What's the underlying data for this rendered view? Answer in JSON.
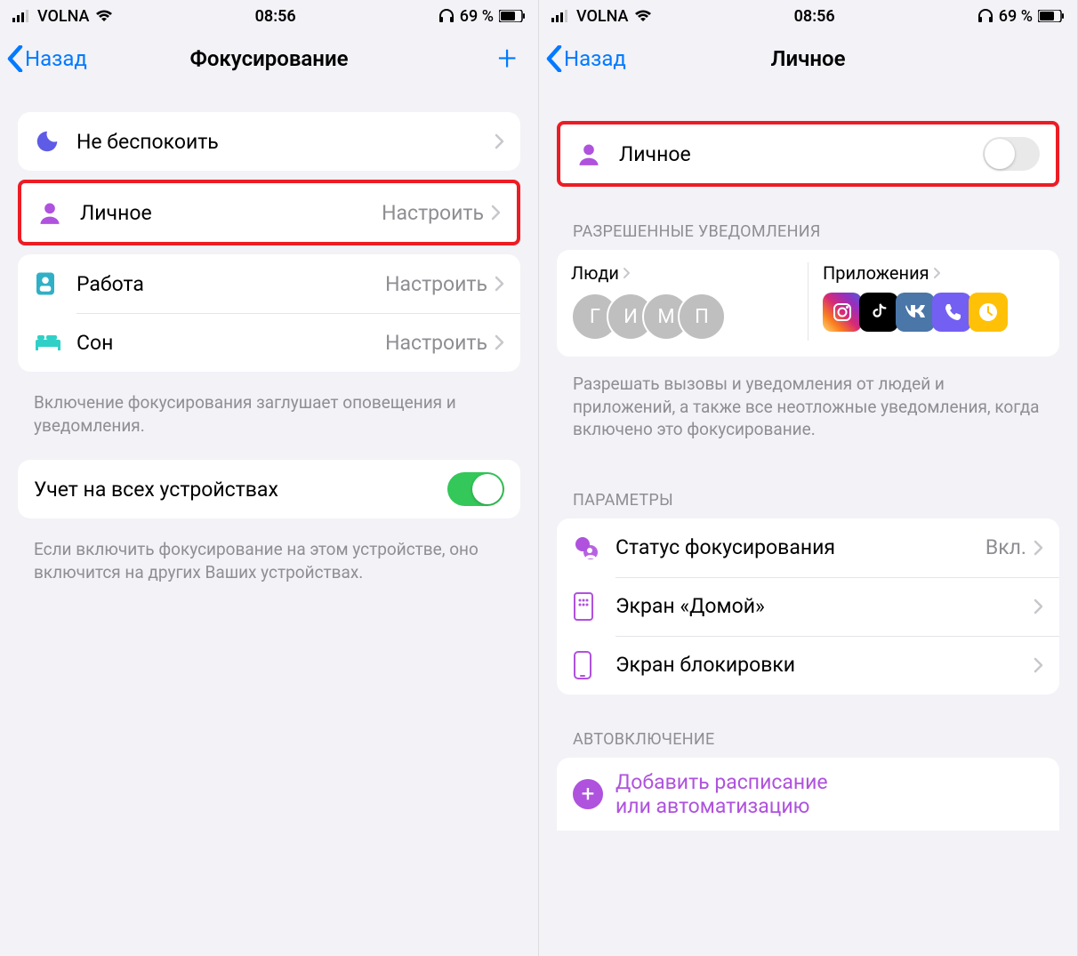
{
  "status": {
    "carrier": "VOLNA",
    "time": "08:56",
    "battery": "69 %"
  },
  "left": {
    "back": "Назад",
    "title": "Фокусирование",
    "focus": {
      "dnd": "Не беспокоить",
      "personal": "Личное",
      "work": "Работа",
      "sleep": "Сон",
      "configure": "Настроить"
    },
    "footer1": "Включение фокусирования заглушает оповещения и уведомления.",
    "share_label": "Учет на всех устройствах",
    "footer2": "Если включить фокусирование на этом устройстве, оно включится на других Ваших устройствах."
  },
  "right": {
    "back": "Назад",
    "title": "Личное",
    "personal_label": "Личное",
    "allowed_header": "РАЗРЕШЕННЫЕ УВЕДОМЛЕНИЯ",
    "people_label": "Люди",
    "apps_label": "Приложения",
    "people_initials": [
      "Г",
      "И",
      "М",
      "П"
    ],
    "allowed_footer": "Разрешать вызовы и уведомления от людей и приложений, а также все неотложные уведомления, когда включено это фокусирование.",
    "params_header": "ПАРАМЕТРЫ",
    "params": {
      "status": "Статус фокусирования",
      "status_value": "Вкл.",
      "home": "Экран «Домой»",
      "lock": "Экран блокировки"
    },
    "auto_header": "АВТОВКЛЮЧЕНИЕ",
    "add_line1": "Добавить расписание",
    "add_line2": "или автоматизацию"
  }
}
